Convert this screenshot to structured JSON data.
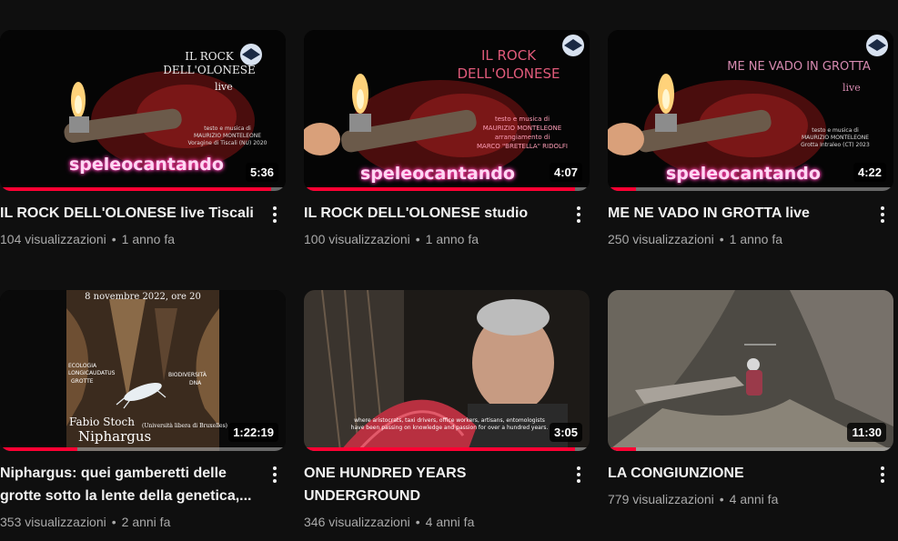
{
  "videos": [
    {
      "title": "IL ROCK DELL'OLONESE live Tiscali",
      "views": "104 visualizzazioni",
      "age": "1 anno fa",
      "duration": "5:36",
      "progress": 0.95,
      "thumb": {
        "brand": "speleocantando",
        "heading": "IL ROCK\nDELL'OLONESE",
        "sub": "live",
        "credits": "testo e musica di\nMAURIZIO MONTELEONE\nVoragine di Tiscali (NU) 2020"
      }
    },
    {
      "title": "IL ROCK DELL'OLONESE studio",
      "views": "100 visualizzazioni",
      "age": "1 anno fa",
      "duration": "4:07",
      "progress": 0.95,
      "thumb": {
        "brand": "speleocantando",
        "heading": "IL ROCK\nDELL'OLONESE",
        "credits": "testo e musica di\nMAURIZIO MONTELEONE\narrangiamento di\nMARCO \"BRETELLA\" RIDOLFI"
      }
    },
    {
      "title": "ME NE VADO IN GROTTA live",
      "views": "250 visualizzazioni",
      "age": "1 anno fa",
      "duration": "4:22",
      "progress": 0.1,
      "thumb": {
        "brand": "speleocantando",
        "heading": "ME NE VADO IN GROTTA",
        "sub": "live",
        "credits": "testo e musica di\nMAURIZIO MONTELEONE\nGrotta Intraleo (CT) 2023"
      }
    },
    {
      "title": "Niphargus: quei gamberetti delle grotte sotto la lente della genetica,...",
      "views": "353 visualizzazioni",
      "age": "2 anni fa",
      "duration": "1:22:19",
      "progress": 0.27,
      "thumb": {
        "date": "8 novembre 2022, ore 20",
        "speaker": "Fabio Stoch",
        "affiliation": "(Università libera di Bruxelles)",
        "name": "Niphargus",
        "words": [
          "ECOLOGIA",
          "LONGICAUDATUS",
          "GROTTE",
          "BIODIVERSITÀ",
          "DNA"
        ]
      }
    },
    {
      "title": "ONE HUNDRED YEARS UNDERGROUND",
      "views": "346 visualizzazioni",
      "age": "4 anni fa",
      "duration": "3:05",
      "progress": 0.95,
      "thumb": {
        "subtitle": "where aristocrats, taxi drivers, office workers, artisans, entomologists\nhave been passing on knowledge and passion for over a hundred years."
      }
    },
    {
      "title": "LA CONGIUNZIONE",
      "views": "779 visualizzazioni",
      "age": "4 anni fa",
      "duration": "11:30",
      "progress": 0.1,
      "thumb": {}
    }
  ]
}
